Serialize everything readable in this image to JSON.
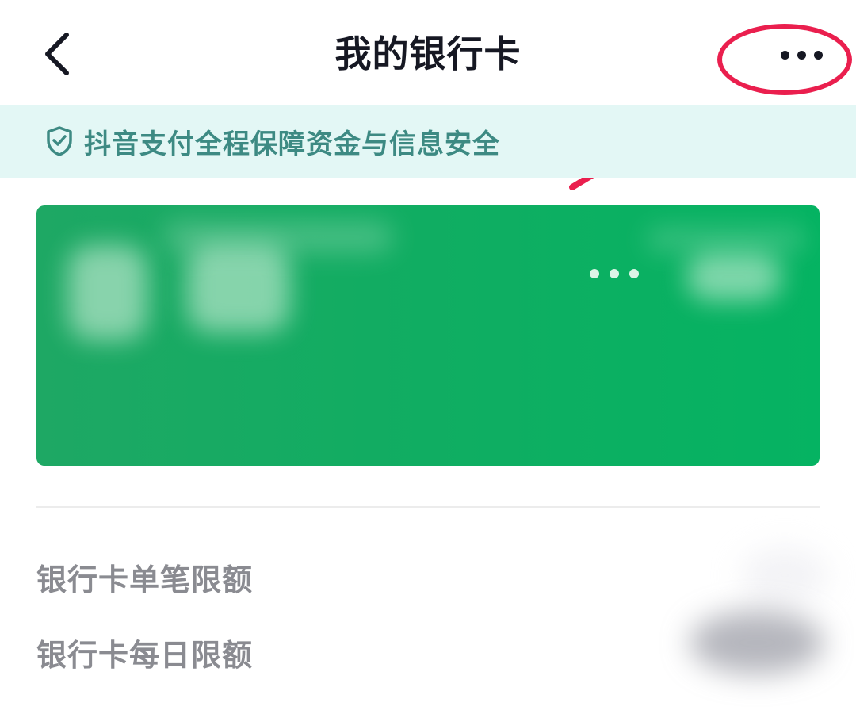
{
  "header": {
    "title": "我的银行卡",
    "back_icon": "chevron-left-icon",
    "more_icon": "more-horizontal-icon"
  },
  "security_banner": {
    "icon": "shield-check-icon",
    "text": "抖音支付全程保障资金与信息安全"
  },
  "bank_card": {
    "masked_number": "•••"
  },
  "limits": {
    "items": [
      {
        "label": "银行卡单笔限额"
      },
      {
        "label": "银行卡每日限额"
      }
    ]
  },
  "colors": {
    "annotation": "#ea1f4e",
    "card_green": "#10ad62",
    "banner_bg": "#e3f7f5",
    "banner_text": "#3d8a83"
  }
}
